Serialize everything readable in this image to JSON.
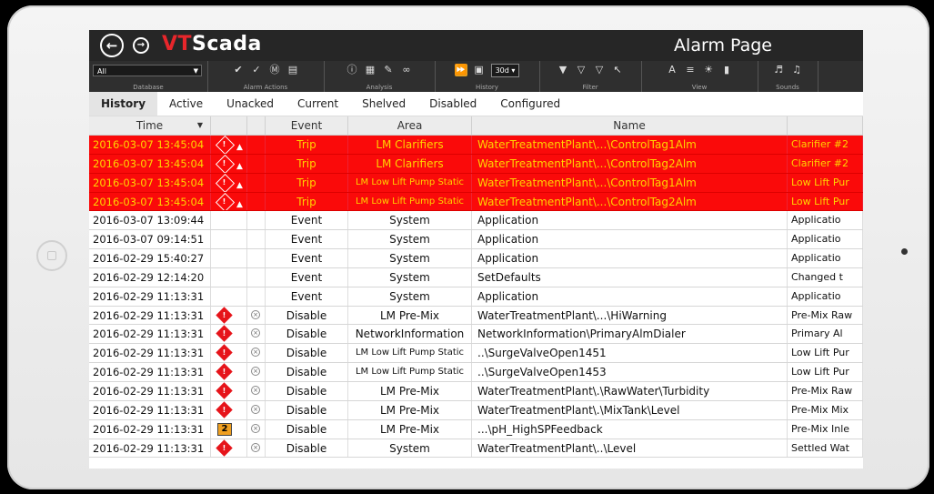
{
  "app": {
    "brand_v": "VT",
    "brand_rest": "Scada",
    "page_title": "Alarm Page"
  },
  "toolbar": {
    "database_value": "All",
    "groups": {
      "database": "Database",
      "alarm_actions": "Alarm Actions",
      "analysis": "Analysis",
      "history": "History",
      "filter": "Filter",
      "view": "View",
      "sounds": "Sounds"
    },
    "history_range": "30d"
  },
  "tabs": [
    "History",
    "Active",
    "Unacked",
    "Current",
    "Shelved",
    "Disabled",
    "Configured"
  ],
  "columns": {
    "time": "Time",
    "event": "Event",
    "area": "Area",
    "name": "Name"
  },
  "rows": [
    {
      "time": "2016-03-07  13:45:04",
      "event": "Trip",
      "area": "LM Clarifiers",
      "name": "WaterTreatmentPlant\\...\\ControlTag1Alm",
      "desc": "Clarifier #2",
      "style": "alarm"
    },
    {
      "time": "2016-03-07  13:45:04",
      "event": "Trip",
      "area": "LM Clarifiers",
      "name": "WaterTreatmentPlant\\...\\ControlTag2Alm",
      "desc": "Clarifier #2",
      "style": "alarm"
    },
    {
      "time": "2016-03-07  13:45:04",
      "event": "Trip",
      "area": "LM Low Lift Pump Static",
      "name": "WaterTreatmentPlant\\...\\ControlTag1Alm",
      "desc": "Low Lift Pur",
      "style": "alarm"
    },
    {
      "time": "2016-03-07  13:45:04",
      "event": "Trip",
      "area": "LM Low Lift Pump Static",
      "name": "WaterTreatmentPlant\\...\\ControlTag2Alm",
      "desc": "Low Lift Pur",
      "style": "alarm"
    },
    {
      "time": "2016-03-07  13:09:44",
      "event": "Event",
      "area": "System",
      "name": "Application",
      "desc": "Applicatio",
      "style": "event"
    },
    {
      "time": "2016-03-07  09:14:51",
      "event": "Event",
      "area": "System",
      "name": "Application",
      "desc": "Applicatio",
      "style": "event"
    },
    {
      "time": "2016-02-29  15:40:27",
      "event": "Event",
      "area": "System",
      "name": "Application",
      "desc": "Applicatio",
      "style": "event"
    },
    {
      "time": "2016-02-29  12:14:20",
      "event": "Event",
      "area": "System",
      "name": "SetDefaults",
      "desc": "Changed t",
      "style": "event"
    },
    {
      "time": "2016-02-29  11:13:31",
      "event": "Event",
      "area": "System",
      "name": "Application",
      "desc": "Applicatio",
      "style": "event"
    },
    {
      "time": "2016-02-29  11:13:31",
      "event": "Disable",
      "area": "LM Pre-Mix",
      "name": "WaterTreatmentPlant\\...\\HiWarning",
      "desc": "Pre-Mix Raw",
      "style": "disable"
    },
    {
      "time": "2016-02-29  11:13:31",
      "event": "Disable",
      "area": "NetworkInformation",
      "name": "NetworkInformation\\PrimaryAlmDialer",
      "desc": "Primary Al",
      "style": "disable"
    },
    {
      "time": "2016-02-29  11:13:31",
      "event": "Disable",
      "area": "LM Low Lift Pump Static",
      "name": "..\\SurgeValveOpen1451",
      "desc": "Low Lift Pur",
      "style": "disable"
    },
    {
      "time": "2016-02-29  11:13:31",
      "event": "Disable",
      "area": "LM Low Lift Pump Static",
      "name": "..\\SurgeValveOpen1453",
      "desc": "Low Lift Pur",
      "style": "disable"
    },
    {
      "time": "2016-02-29  11:13:31",
      "event": "Disable",
      "area": "LM Pre-Mix",
      "name": "WaterTreatmentPlant\\.\\RawWater\\Turbidity",
      "desc": "Pre-Mix Raw",
      "style": "disable"
    },
    {
      "time": "2016-02-29  11:13:31",
      "event": "Disable",
      "area": "LM Pre-Mix",
      "name": "WaterTreatmentPlant\\.\\MixTank\\Level",
      "desc": "Pre-Mix Mix",
      "style": "disable"
    },
    {
      "time": "2016-02-29  11:13:31",
      "event": "Disable",
      "area": "LM Pre-Mix",
      "name": "...\\pH_HighSPFeedback",
      "desc": "Pre-Mix Inle",
      "style": "disable2",
      "priority": "2"
    },
    {
      "time": "2016-02-29  11:13:31",
      "event": "Disable",
      "area": "System",
      "name": "WaterTreatmentPlant\\..\\Level",
      "desc": "Settled Wat",
      "style": "disable"
    }
  ],
  "priority_mark": "!",
  "colors": {
    "alarm_bg": "#fa0a0a",
    "alarm_text": "#ffd400",
    "brand_red": "#e8262b",
    "titlebar": "#262626"
  }
}
